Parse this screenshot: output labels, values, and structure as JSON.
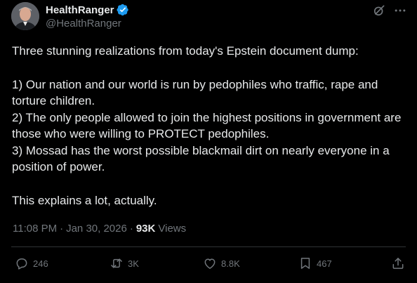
{
  "author": {
    "display_name": "HealthRanger",
    "handle": "@HealthRanger",
    "verified": true,
    "verified_color": "#1d9bf0"
  },
  "header_icons": [
    "grok-icon",
    "more-icon"
  ],
  "tweet": {
    "lines": [
      "Three stunning realizations from today's Epstein document dump:",
      "",
      "1) Our nation and our world is run by pedophiles who traffic, rape and torture children.",
      "2) The only people allowed to join the highest positions in government are those who were willing to PROTECT pedophiles.",
      "3) Mossad has the worst possible blackmail dirt on nearly everyone in a position of power.",
      "",
      "This explains a lot, actually."
    ]
  },
  "meta": {
    "time": "11:08 PM",
    "separator": "·",
    "date": "Jan 30, 2026",
    "views_count": "93K",
    "views_label": "Views"
  },
  "actions": {
    "replies": "246",
    "reposts": "3K",
    "likes": "8.8K",
    "bookmarks": "467"
  },
  "colors": {
    "background": "#000000",
    "text": "#e7e9ea",
    "secondary": "#71767b",
    "divider": "#2f3336"
  }
}
